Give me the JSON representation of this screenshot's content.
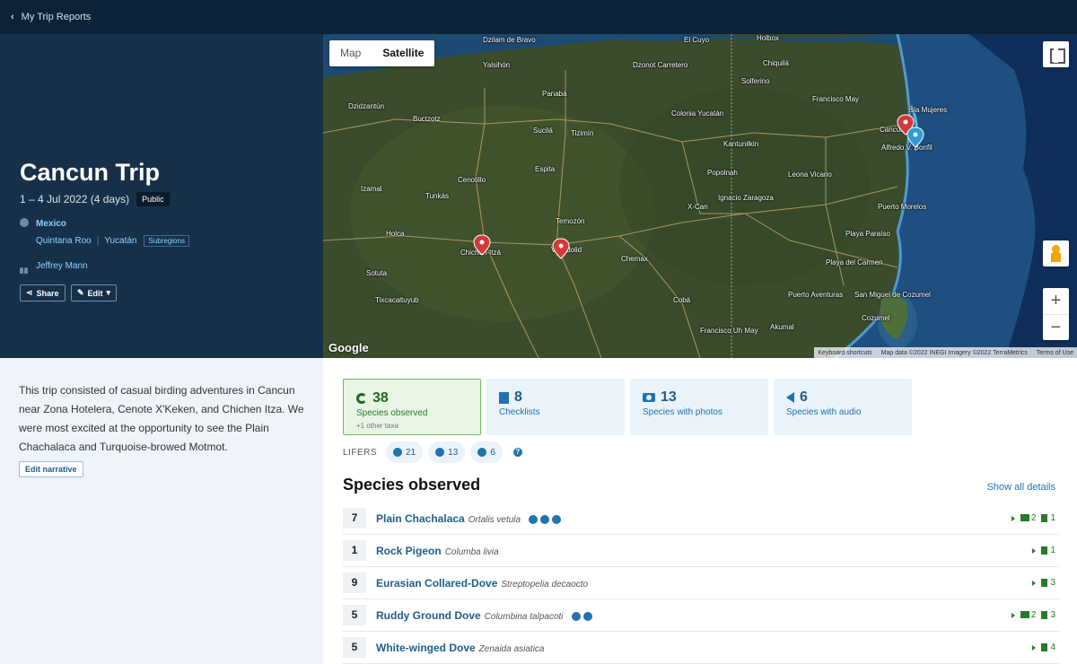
{
  "topbar": {
    "back_label": "My Trip Reports"
  },
  "trip": {
    "title": "Cancun Trip",
    "dates": "1 – 4 Jul 2022 (4 days)",
    "visibility": "Public",
    "country": "Mexico",
    "regions": [
      "Quintana Roo",
      "Yucatán"
    ],
    "subregions_label": "Subregions",
    "owner": "Jeffrey Mann",
    "share_label": "Share",
    "edit_label": "Edit"
  },
  "map": {
    "map_label": "Map",
    "satellite_label": "Satellite",
    "selected_view": "Satellite",
    "google": "Google",
    "attribution": [
      "Keyboard shortcuts",
      "Map data ©2022 INEGI Imagery ©2022 TerraMetrics",
      "Terms of Use"
    ],
    "labels": [
      "Dzilam de Bravo",
      "El Cuyo",
      "Holbox",
      "Chiquilá",
      "Yalsihón",
      "Dzonot Carretero",
      "Solferino",
      "Panabá",
      "Isla Mujeres",
      "Francisco May",
      "Colonia Yucatán",
      "Buctzotz",
      "Sucilá",
      "Tizimín",
      "Cancún",
      "Alfredo V. Bonfil",
      "Kantunilkin",
      "Dzidzantún",
      "Espita",
      "Popolnah",
      "Leona Vicario",
      "Cenotillo",
      "Ignacio Zaragoza",
      "Tunkás",
      "X-Can",
      "Puerto Morelos",
      "Temozón",
      "Holca",
      "Chichén-Itzá",
      "Valladolid",
      "Chemax",
      "Playa Paraíso",
      "Playa del Carmen",
      "Sotuta",
      "Tixcacaltuyub",
      "Cobá",
      "Puerto Aventuras",
      "San Miguel de Cozumel",
      "Cozumel",
      "Francisco Uh May",
      "Akumal",
      "Izamal"
    ]
  },
  "narrative": {
    "text": "This trip consisted of casual birding adventures in Cancun near Zona Hotelera, Cenote X'Keken, and Chichen Itza. We were most excited at the opportunity to see the Plain Chachalaca and Turquoise-browed Motmot.",
    "edit_label": "Edit narrative"
  },
  "stats": [
    {
      "value": "38",
      "label": "Species observed",
      "sub": "+1 other taxa",
      "icon": "leaf-icon"
    },
    {
      "value": "8",
      "label": "Checklists",
      "icon": "checklist-icon"
    },
    {
      "value": "13",
      "label": "Species with photos",
      "icon": "camera-icon"
    },
    {
      "value": "6",
      "label": "Species with audio",
      "icon": "speaker-icon"
    }
  ],
  "lifers": {
    "label": "LIFERS",
    "observed": "21",
    "photos": "13",
    "audio": "6",
    "help": "?"
  },
  "species_section": {
    "title": "Species observed",
    "show_all": "Show all details"
  },
  "species": [
    {
      "count": "7",
      "common": "Plain Chachalaca",
      "scientific": "Ortalis vetula",
      "lifer_marks": 3,
      "photos": "2",
      "checklists": "1"
    },
    {
      "count": "1",
      "common": "Rock Pigeon",
      "scientific": "Columba livia",
      "lifer_marks": 0,
      "photos": "",
      "checklists": "1"
    },
    {
      "count": "9",
      "common": "Eurasian Collared-Dove",
      "scientific": "Streptopelia decaocto",
      "lifer_marks": 0,
      "photos": "",
      "checklists": "3"
    },
    {
      "count": "5",
      "common": "Ruddy Ground Dove",
      "scientific": "Columbina talpacoti",
      "lifer_marks": 2,
      "photos": "2",
      "checklists": "3"
    },
    {
      "count": "5",
      "common": "White-winged Dove",
      "scientific": "Zenaida asiatica",
      "lifer_marks": 0,
      "photos": "",
      "checklists": "4"
    }
  ]
}
